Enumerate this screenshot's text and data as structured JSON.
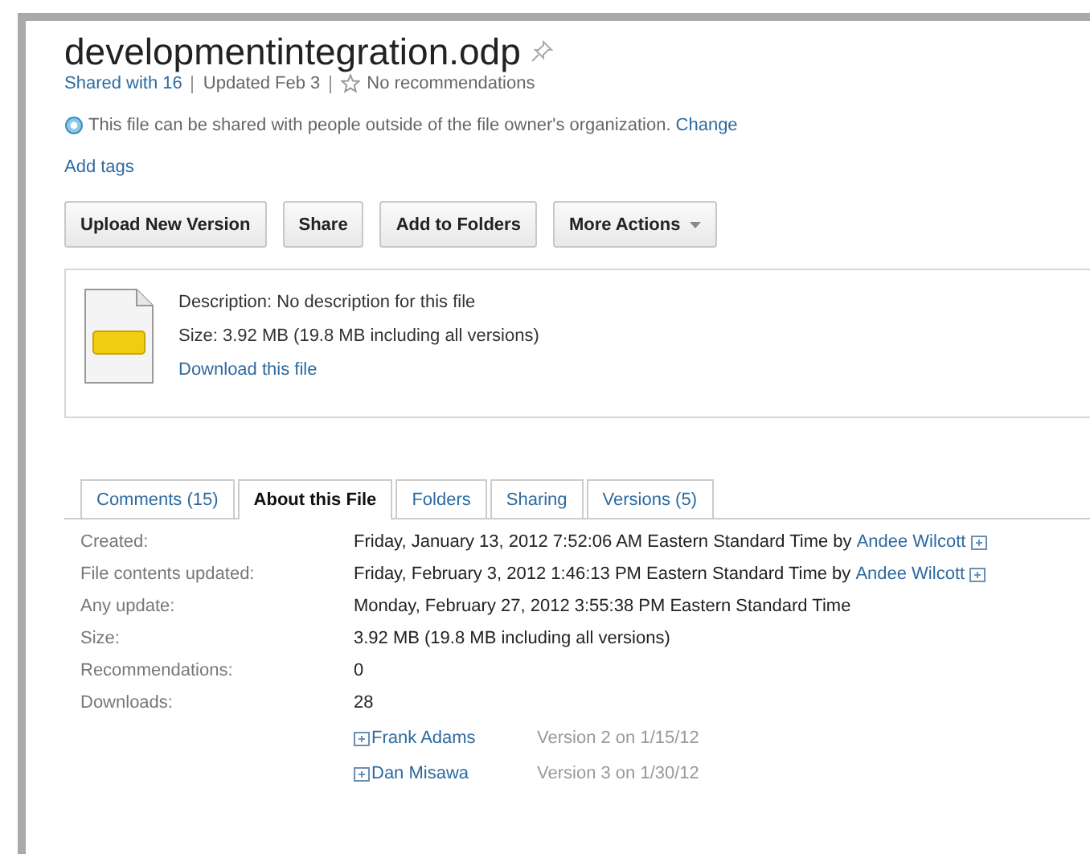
{
  "title": "developmentintegration.odp",
  "meta": {
    "shared": "Shared with 16",
    "updated": "Updated Feb 3",
    "recommendations": "No recommendations"
  },
  "notice": {
    "text": "This file can be shared with people outside of the file owner's organization.",
    "link": "Change"
  },
  "add_tags": "Add tags",
  "buttons": [
    {
      "label": "Upload New Version",
      "dropdown": false
    },
    {
      "label": "Share",
      "dropdown": false
    },
    {
      "label": "Add to Folders",
      "dropdown": false
    },
    {
      "label": "More Actions",
      "dropdown": true
    }
  ],
  "file_card": {
    "description": "Description: No description for this file",
    "size": "Size: 3.92 MB (19.8 MB including all versions)",
    "download": "Download this file"
  },
  "tabs": [
    {
      "label": "Comments (15)",
      "selected": false
    },
    {
      "label": "About this File",
      "selected": true
    },
    {
      "label": "Folders",
      "selected": false
    },
    {
      "label": "Sharing",
      "selected": false
    },
    {
      "label": "Versions (5)",
      "selected": false
    }
  ],
  "details": [
    {
      "label": "Created:",
      "value": "Friday, January 13, 2012 7:52:06 AM Eastern Standard Time by",
      "person": "Andee Wilcott"
    },
    {
      "label": "File contents updated:",
      "value": "Friday, February 3, 2012 1:46:13 PM Eastern Standard Time by",
      "person": "Andee Wilcott"
    },
    {
      "label": "Any update:",
      "value": "Monday, February 27, 2012 3:55:38 PM Eastern Standard Time"
    },
    {
      "label": "Size:",
      "value": "3.92 MB (19.8 MB including all versions)"
    },
    {
      "label": "Recommendations:",
      "value": "0"
    },
    {
      "label": "Downloads:",
      "value": "28"
    }
  ],
  "downloaders": [
    {
      "name": "Frank Adams",
      "version": "Version 2 on 1/15/12"
    },
    {
      "name": "Dan Misawa",
      "version": "Version 3 on 1/30/12"
    }
  ]
}
